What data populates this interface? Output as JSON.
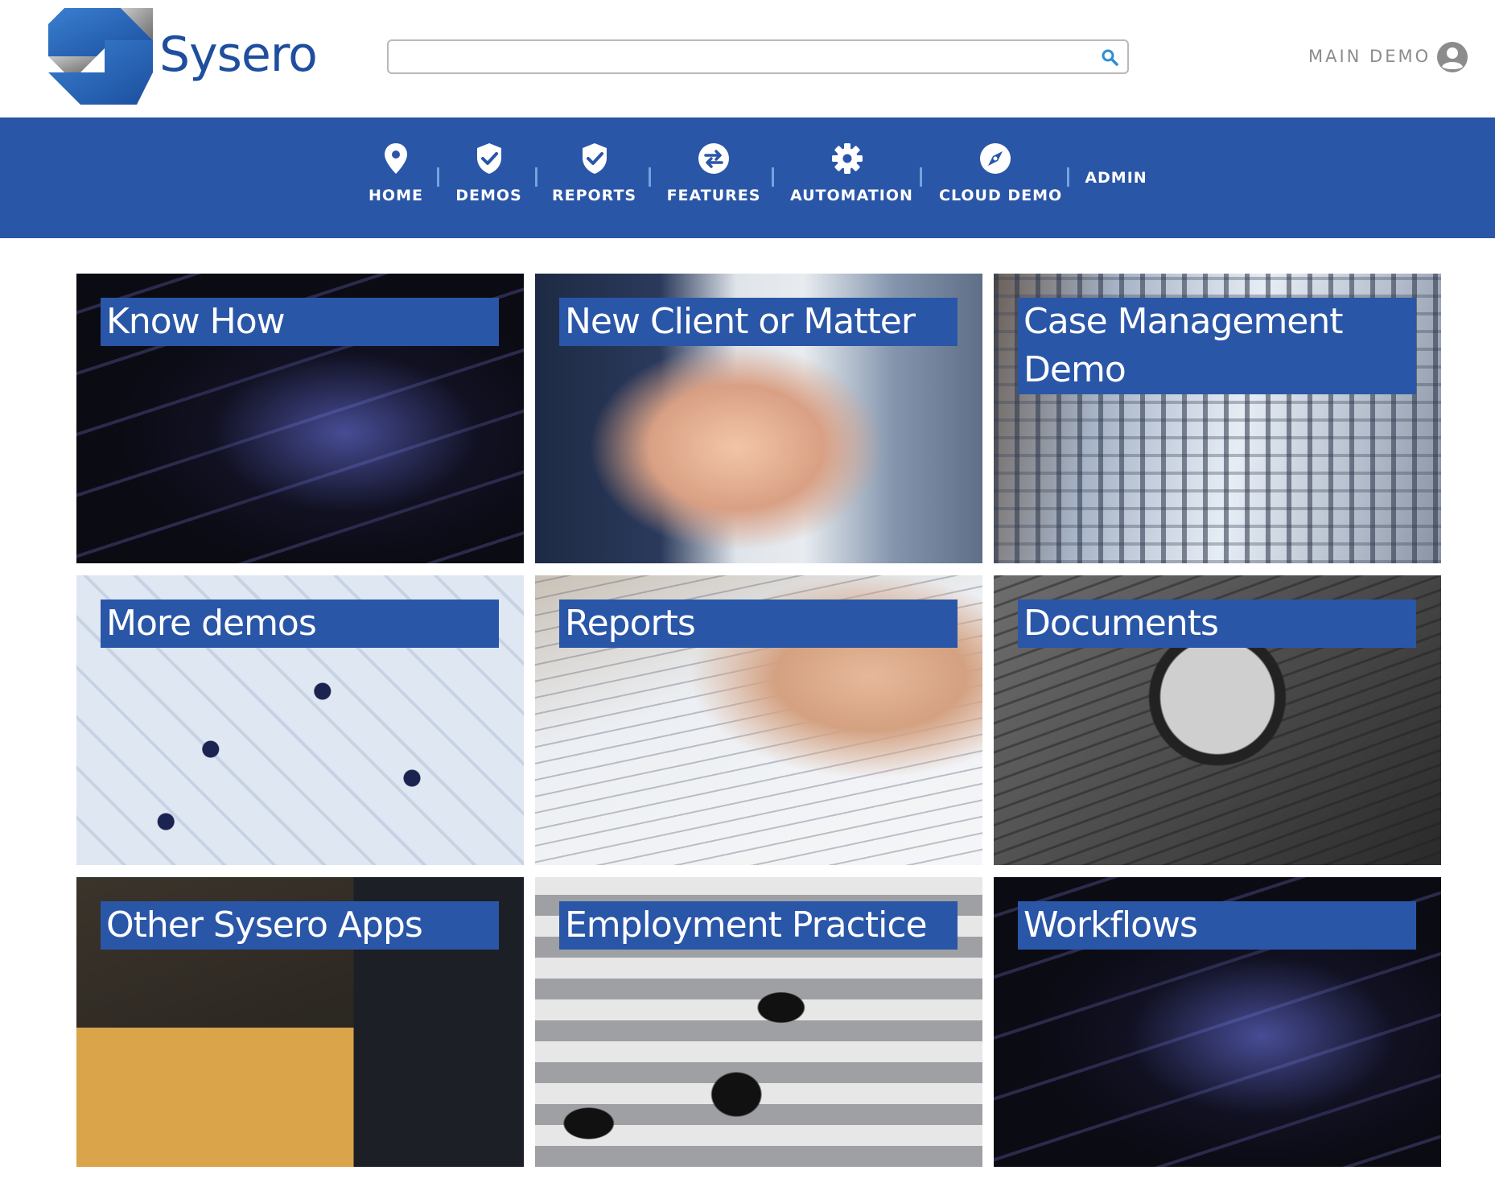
{
  "brand": {
    "name": "Sysero",
    "color": "#1f4e9e"
  },
  "search": {
    "placeholder": "",
    "value": ""
  },
  "user": {
    "name": "MAIN DEMO"
  },
  "nav": {
    "color": "#2a56a8",
    "items": [
      {
        "label": "HOME",
        "icon": "map-pin-icon"
      },
      {
        "label": "DEMOS",
        "icon": "shield-check-icon"
      },
      {
        "label": "REPORTS",
        "icon": "shield-check-icon"
      },
      {
        "label": "FEATURES",
        "icon": "swap-arrows-icon"
      },
      {
        "label": "AUTOMATION",
        "icon": "gear-icon"
      },
      {
        "label": "CLOUD DEMO",
        "icon": "compass-icon"
      },
      {
        "label": "ADMIN",
        "icon": ""
      }
    ]
  },
  "tiles": [
    {
      "title": "Know How"
    },
    {
      "title": "New Client or Matter"
    },
    {
      "title": "Case Management Demo"
    },
    {
      "title": "More demos"
    },
    {
      "title": "Reports"
    },
    {
      "title": "Documents"
    },
    {
      "title": "Other Sysero Apps"
    },
    {
      "title": "Employment Practice"
    },
    {
      "title": "Workflows"
    }
  ]
}
